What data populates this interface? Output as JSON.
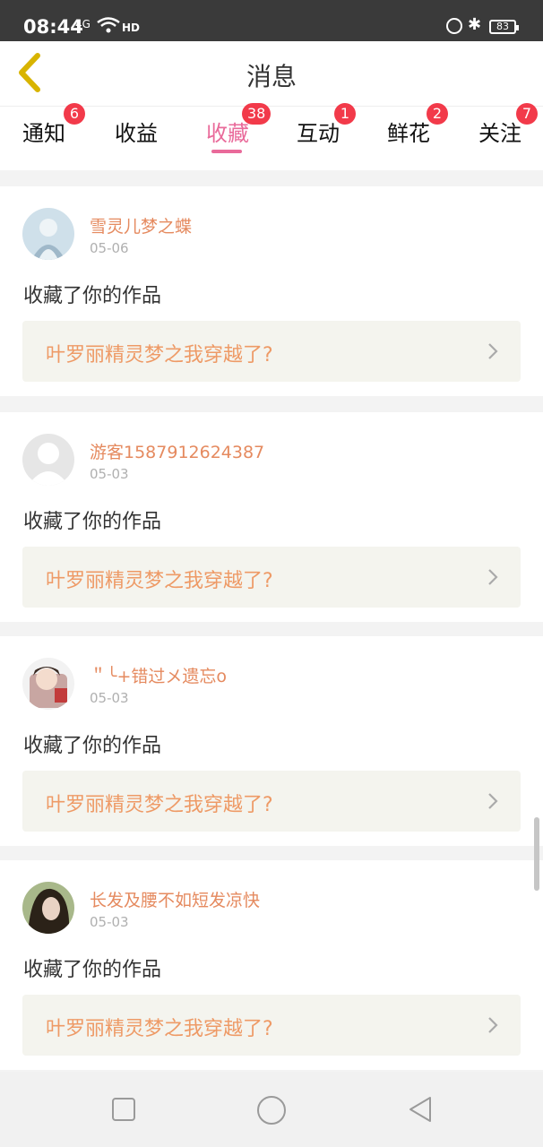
{
  "status_bar": {
    "time": "08:44",
    "signal": "4G",
    "network_tag": "HD",
    "battery": "83"
  },
  "header": {
    "title": "消息"
  },
  "tabs": [
    {
      "label": "通知",
      "badge": "6"
    },
    {
      "label": "收益",
      "badge": ""
    },
    {
      "label": "收藏",
      "badge": "38",
      "active": true
    },
    {
      "label": "互动",
      "badge": "1"
    },
    {
      "label": "鲜花",
      "badge": "2"
    },
    {
      "label": "关注",
      "badge": "7"
    }
  ],
  "items": [
    {
      "username": "雪灵儿梦之蝶",
      "date": "05-06",
      "action": "收藏了你的作品",
      "work": "叶罗丽精灵梦之我穿越了?"
    },
    {
      "username": "游客1587912624387",
      "date": "05-03",
      "action": "收藏了你的作品",
      "work": "叶罗丽精灵梦之我穿越了?"
    },
    {
      "username": "＂╰+错过メ遗忘o",
      "date": "05-03",
      "action": "收藏了你的作品",
      "work": "叶罗丽精灵梦之我穿越了?"
    },
    {
      "username": "长发及腰不如短发凉快",
      "date": "05-03",
      "action": "收藏了你的作品",
      "work": "叶罗丽精灵梦之我穿越了?"
    }
  ],
  "colors": {
    "accent": "#e96a9a",
    "username": "#e58a5f",
    "work_title": "#ee9a66",
    "badge": "#f23a4a"
  }
}
